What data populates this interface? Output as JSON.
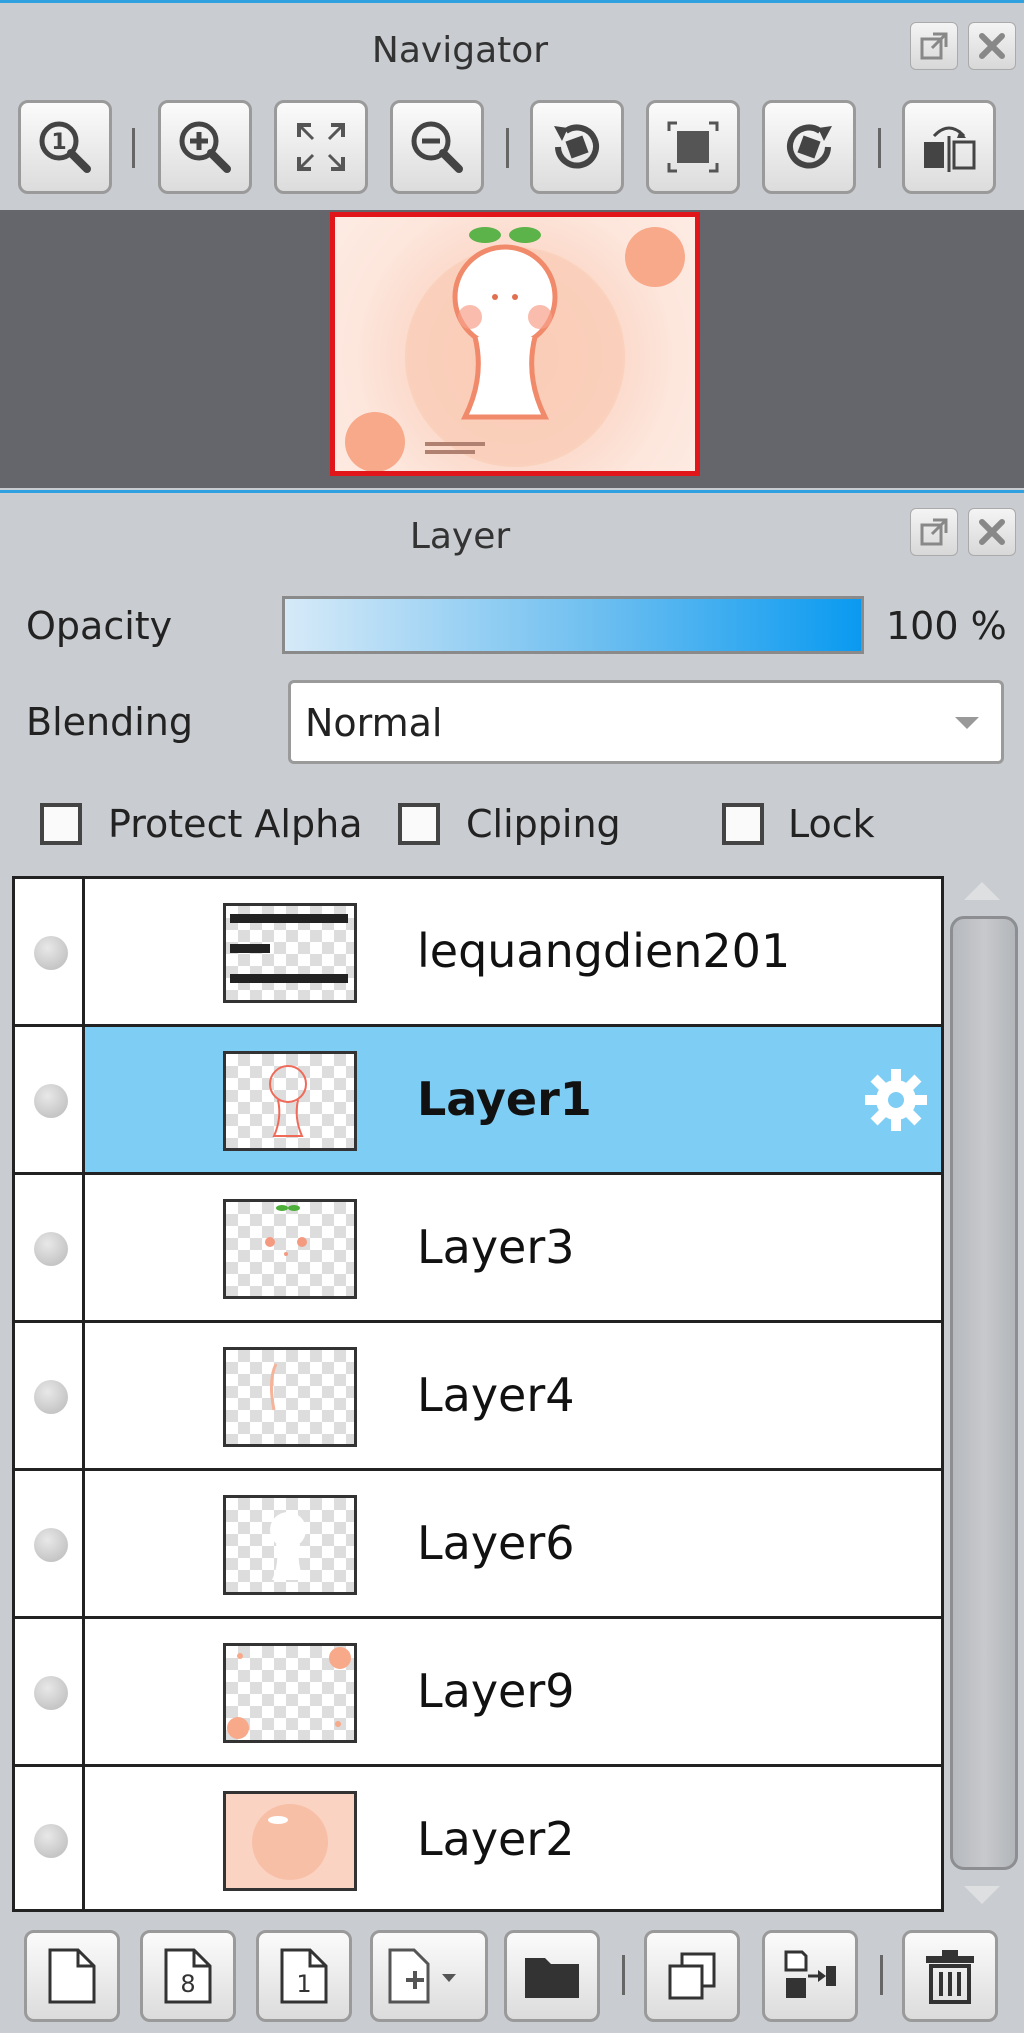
{
  "navigator": {
    "title": "Navigator",
    "toolbar": [
      {
        "name": "zoom-actual-button",
        "icon": "zoom-1-icon"
      },
      {
        "name": "zoom-in-button",
        "icon": "zoom-in-icon"
      },
      {
        "name": "fit-window-button",
        "icon": "fit-icon"
      },
      {
        "name": "zoom-out-button",
        "icon": "zoom-out-icon"
      },
      {
        "name": "rotate-left-button",
        "icon": "rotate-left-icon"
      },
      {
        "name": "reset-view-button",
        "icon": "reset-icon"
      },
      {
        "name": "rotate-right-button",
        "icon": "rotate-right-icon"
      },
      {
        "name": "flip-horizontal-button",
        "icon": "flip-icon"
      }
    ],
    "preview_border_color": "#e0161a"
  },
  "layer_panel": {
    "title": "Layer",
    "opacity_label": "Opacity",
    "opacity_value": "100 %",
    "opacity_fraction": 1.0,
    "blending_label": "Blending",
    "blending_value": "Normal",
    "protect_alpha_label": "Protect Alpha",
    "clipping_label": "Clipping",
    "lock_label": "Lock",
    "accent_color": "#7ecdf5",
    "layers": [
      {
        "name": "lequangdien201",
        "selected": false,
        "thumb": "text"
      },
      {
        "name": "Layer1",
        "selected": true,
        "thumb": "outline"
      },
      {
        "name": "Layer3",
        "selected": false,
        "thumb": "face"
      },
      {
        "name": "Layer4",
        "selected": false,
        "thumb": "stroke"
      },
      {
        "name": "Layer6",
        "selected": false,
        "thumb": "white"
      },
      {
        "name": "Layer9",
        "selected": false,
        "thumb": "corners"
      },
      {
        "name": "Layer2",
        "selected": false,
        "thumb": "fill"
      }
    ],
    "bottom_toolbar": [
      {
        "name": "new-layer-button",
        "icon": "new-page-icon"
      },
      {
        "name": "new-8bit-layer-button",
        "icon": "page-8-icon"
      },
      {
        "name": "new-1bit-layer-button",
        "icon": "page-1-icon"
      },
      {
        "name": "add-layer-menu-button",
        "icon": "page-plus-icon"
      },
      {
        "name": "new-folder-button",
        "icon": "folder-icon"
      },
      {
        "name": "duplicate-layer-button",
        "icon": "duplicate-icon"
      },
      {
        "name": "merge-down-button",
        "icon": "merge-icon"
      },
      {
        "name": "delete-layer-button",
        "icon": "trash-icon"
      }
    ]
  }
}
